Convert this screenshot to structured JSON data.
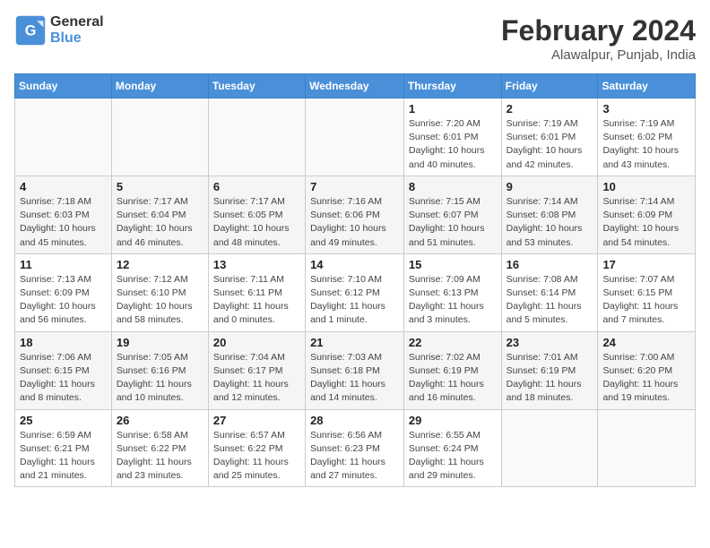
{
  "logo": {
    "line1": "General",
    "line2": "Blue"
  },
  "title": "February 2024",
  "subtitle": "Alawalpur, Punjab, India",
  "weekdays": [
    "Sunday",
    "Monday",
    "Tuesday",
    "Wednesday",
    "Thursday",
    "Friday",
    "Saturday"
  ],
  "weeks": [
    [
      {
        "num": "",
        "detail": ""
      },
      {
        "num": "",
        "detail": ""
      },
      {
        "num": "",
        "detail": ""
      },
      {
        "num": "",
        "detail": ""
      },
      {
        "num": "1",
        "detail": "Sunrise: 7:20 AM\nSunset: 6:01 PM\nDaylight: 10 hours\nand 40 minutes."
      },
      {
        "num": "2",
        "detail": "Sunrise: 7:19 AM\nSunset: 6:01 PM\nDaylight: 10 hours\nand 42 minutes."
      },
      {
        "num": "3",
        "detail": "Sunrise: 7:19 AM\nSunset: 6:02 PM\nDaylight: 10 hours\nand 43 minutes."
      }
    ],
    [
      {
        "num": "4",
        "detail": "Sunrise: 7:18 AM\nSunset: 6:03 PM\nDaylight: 10 hours\nand 45 minutes."
      },
      {
        "num": "5",
        "detail": "Sunrise: 7:17 AM\nSunset: 6:04 PM\nDaylight: 10 hours\nand 46 minutes."
      },
      {
        "num": "6",
        "detail": "Sunrise: 7:17 AM\nSunset: 6:05 PM\nDaylight: 10 hours\nand 48 minutes."
      },
      {
        "num": "7",
        "detail": "Sunrise: 7:16 AM\nSunset: 6:06 PM\nDaylight: 10 hours\nand 49 minutes."
      },
      {
        "num": "8",
        "detail": "Sunrise: 7:15 AM\nSunset: 6:07 PM\nDaylight: 10 hours\nand 51 minutes."
      },
      {
        "num": "9",
        "detail": "Sunrise: 7:14 AM\nSunset: 6:08 PM\nDaylight: 10 hours\nand 53 minutes."
      },
      {
        "num": "10",
        "detail": "Sunrise: 7:14 AM\nSunset: 6:09 PM\nDaylight: 10 hours\nand 54 minutes."
      }
    ],
    [
      {
        "num": "11",
        "detail": "Sunrise: 7:13 AM\nSunset: 6:09 PM\nDaylight: 10 hours\nand 56 minutes."
      },
      {
        "num": "12",
        "detail": "Sunrise: 7:12 AM\nSunset: 6:10 PM\nDaylight: 10 hours\nand 58 minutes."
      },
      {
        "num": "13",
        "detail": "Sunrise: 7:11 AM\nSunset: 6:11 PM\nDaylight: 11 hours\nand 0 minutes."
      },
      {
        "num": "14",
        "detail": "Sunrise: 7:10 AM\nSunset: 6:12 PM\nDaylight: 11 hours\nand 1 minute."
      },
      {
        "num": "15",
        "detail": "Sunrise: 7:09 AM\nSunset: 6:13 PM\nDaylight: 11 hours\nand 3 minutes."
      },
      {
        "num": "16",
        "detail": "Sunrise: 7:08 AM\nSunset: 6:14 PM\nDaylight: 11 hours\nand 5 minutes."
      },
      {
        "num": "17",
        "detail": "Sunrise: 7:07 AM\nSunset: 6:15 PM\nDaylight: 11 hours\nand 7 minutes."
      }
    ],
    [
      {
        "num": "18",
        "detail": "Sunrise: 7:06 AM\nSunset: 6:15 PM\nDaylight: 11 hours\nand 8 minutes."
      },
      {
        "num": "19",
        "detail": "Sunrise: 7:05 AM\nSunset: 6:16 PM\nDaylight: 11 hours\nand 10 minutes."
      },
      {
        "num": "20",
        "detail": "Sunrise: 7:04 AM\nSunset: 6:17 PM\nDaylight: 11 hours\nand 12 minutes."
      },
      {
        "num": "21",
        "detail": "Sunrise: 7:03 AM\nSunset: 6:18 PM\nDaylight: 11 hours\nand 14 minutes."
      },
      {
        "num": "22",
        "detail": "Sunrise: 7:02 AM\nSunset: 6:19 PM\nDaylight: 11 hours\nand 16 minutes."
      },
      {
        "num": "23",
        "detail": "Sunrise: 7:01 AM\nSunset: 6:19 PM\nDaylight: 11 hours\nand 18 minutes."
      },
      {
        "num": "24",
        "detail": "Sunrise: 7:00 AM\nSunset: 6:20 PM\nDaylight: 11 hours\nand 19 minutes."
      }
    ],
    [
      {
        "num": "25",
        "detail": "Sunrise: 6:59 AM\nSunset: 6:21 PM\nDaylight: 11 hours\nand 21 minutes."
      },
      {
        "num": "26",
        "detail": "Sunrise: 6:58 AM\nSunset: 6:22 PM\nDaylight: 11 hours\nand 23 minutes."
      },
      {
        "num": "27",
        "detail": "Sunrise: 6:57 AM\nSunset: 6:22 PM\nDaylight: 11 hours\nand 25 minutes."
      },
      {
        "num": "28",
        "detail": "Sunrise: 6:56 AM\nSunset: 6:23 PM\nDaylight: 11 hours\nand 27 minutes."
      },
      {
        "num": "29",
        "detail": "Sunrise: 6:55 AM\nSunset: 6:24 PM\nDaylight: 11 hours\nand 29 minutes."
      },
      {
        "num": "",
        "detail": ""
      },
      {
        "num": "",
        "detail": ""
      }
    ]
  ]
}
